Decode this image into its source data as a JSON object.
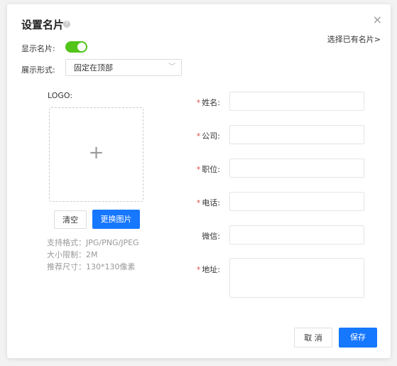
{
  "dialog": {
    "title": "设置名片",
    "choose_existing": "选择已有名片>",
    "close": "×"
  },
  "settings": {
    "show_card_label": "显示名片:",
    "show_card_on": true,
    "display_mode_label": "展示形式:",
    "display_mode_value": "固定在顶部"
  },
  "logo": {
    "label": "LOGO:",
    "clear_label": "清空",
    "change_label": "更换图片",
    "hints": [
      "支持格式：JPG/PNG/JPEG",
      "大小限制：2M",
      "推荐尺寸：130*130像素"
    ]
  },
  "form": {
    "name_label": "姓名:",
    "company_label": "公司:",
    "position_label": "职位:",
    "phone_label": "电话:",
    "wechat_label": "微信:",
    "address_label": "地址:",
    "required_mark": "*"
  },
  "footer": {
    "cancel_label": "取 消",
    "save_label": "保存"
  },
  "colors": {
    "primary": "#1677ff",
    "toggle_on": "#52c41a",
    "required": "#e34d4d"
  }
}
